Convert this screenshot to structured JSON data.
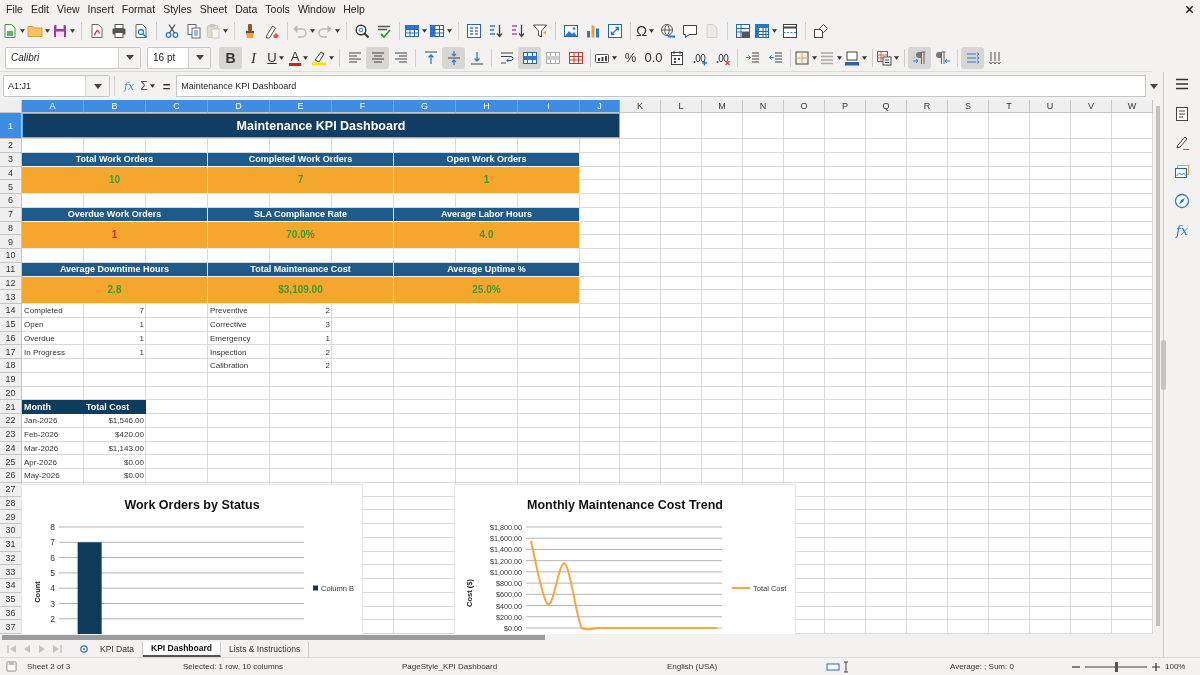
{
  "menu": [
    "File",
    "Edit",
    "View",
    "Insert",
    "Format",
    "Styles",
    "Sheet",
    "Data",
    "Tools",
    "Window",
    "Help"
  ],
  "standard_toolbar": [
    {
      "disabled": false
    },
    {
      "disabled": false
    },
    {
      "disabled": false
    },
    {
      "disabled": false
    },
    {
      "disabled": false
    },
    {
      "disabled": false
    },
    {
      "disabled": false
    },
    {
      "disabled": false
    },
    {
      "disabled": true
    },
    {
      "disabled": false
    },
    {
      "disabled": false
    },
    {
      "disabled": true
    },
    {
      "disabled": true
    },
    {
      "disabled": false
    },
    {
      "disabled": false
    },
    {
      "disabled": false
    },
    {
      "disabled": false
    },
    {
      "disabled": false
    },
    {
      "disabled": false
    },
    {
      "disabled": false
    },
    {
      "disabled": false
    },
    {
      "disabled": false
    },
    {
      "disabled": false
    },
    {
      "disabled": false
    },
    {
      "label": "Ω",
      "disabled": false
    },
    {
      "disabled": false
    },
    {
      "disabled": false
    },
    {
      "disabled": true
    },
    {
      "disabled": false
    },
    {
      "disabled": false
    },
    {
      "disabled": false
    },
    {
      "disabled": false
    }
  ],
  "formatting_toolbar": {
    "font_name": "Calibri",
    "font_size": "16 pt",
    "buttons": [
      {
        "label": "B",
        "selected": true
      },
      {
        "label": "I",
        "selected": false
      },
      {
        "label": "U",
        "selected": false
      },
      {
        "label": "A",
        "selected": false
      },
      {
        "selected": false
      },
      {
        "selected": false
      },
      {
        "selected": true
      },
      {
        "selected": false
      },
      {
        "selected": false
      },
      {
        "selected": true
      },
      {
        "selected": false
      },
      {
        "selected": false
      },
      {
        "selected": true
      },
      {
        "selected": false
      },
      {
        "selected": false
      },
      {
        "selected": false
      },
      {
        "label": "%",
        "selected": false
      },
      {
        "label": "0.0",
        "selected": false
      },
      {
        "selected": false
      },
      {
        "selected": false
      },
      {
        "selected": false
      },
      {
        "selected": false
      },
      {
        "selected": false
      },
      {
        "selected": false
      },
      {
        "selected": false
      },
      {
        "selected": false
      },
      {
        "selected": false
      },
      {
        "selected": true
      },
      {
        "selected": false
      },
      {
        "selected": true
      },
      {
        "selected": false
      }
    ]
  },
  "formula_bar": {
    "name_box": "A1:J1",
    "function_wizard": "fx",
    "sum": "Σ",
    "equals": "=",
    "content": "Maintenance KPI Dashboard"
  },
  "sidebar": {
    "functions": "fx"
  },
  "columns": [
    {
      "label": "A",
      "selected": true
    },
    {
      "label": "B",
      "selected": true
    },
    {
      "label": "C",
      "selected": true
    },
    {
      "label": "D",
      "selected": true
    },
    {
      "label": "E",
      "selected": true
    },
    {
      "label": "F",
      "selected": true
    },
    {
      "label": "G",
      "selected": true
    },
    {
      "label": "H",
      "selected": true
    },
    {
      "label": "I",
      "selected": true
    },
    {
      "label": "J",
      "selected": true
    },
    {
      "label": "K",
      "selected": false
    },
    {
      "label": "L",
      "selected": false
    },
    {
      "label": "M",
      "selected": false
    },
    {
      "label": "N",
      "selected": false
    },
    {
      "label": "O",
      "selected": false
    },
    {
      "label": "P",
      "selected": false
    },
    {
      "label": "Q",
      "selected": false
    },
    {
      "label": "R",
      "selected": false
    },
    {
      "label": "S",
      "selected": false
    },
    {
      "label": "T",
      "selected": false
    },
    {
      "label": "U",
      "selected": false
    },
    {
      "label": "V",
      "selected": false
    },
    {
      "label": "W",
      "selected": false
    }
  ],
  "rows": [
    {
      "label": "1",
      "selected": true
    },
    {
      "label": "2",
      "selected": false
    },
    {
      "label": "3",
      "selected": false
    },
    {
      "label": "4",
      "selected": false
    },
    {
      "label": "5",
      "selected": false
    },
    {
      "label": "6",
      "selected": false
    },
    {
      "label": "7",
      "selected": false
    },
    {
      "label": "8",
      "selected": false
    },
    {
      "label": "9",
      "selected": false
    },
    {
      "label": "10",
      "selected": false
    },
    {
      "label": "11",
      "selected": false
    },
    {
      "label": "12",
      "selected": false
    },
    {
      "label": "13",
      "selected": false
    },
    {
      "label": "14",
      "selected": false
    },
    {
      "label": "15",
      "selected": false
    },
    {
      "label": "16",
      "selected": false
    },
    {
      "label": "17",
      "selected": false
    },
    {
      "label": "18",
      "selected": false
    },
    {
      "label": "19",
      "selected": false
    },
    {
      "label": "20",
      "selected": false
    },
    {
      "label": "21",
      "selected": false
    },
    {
      "label": "22",
      "selected": false
    },
    {
      "label": "23",
      "selected": false
    },
    {
      "label": "24",
      "selected": false
    },
    {
      "label": "25",
      "selected": false
    },
    {
      "label": "26",
      "selected": false
    },
    {
      "label": "27",
      "selected": false
    },
    {
      "label": "28",
      "selected": false
    },
    {
      "label": "29",
      "selected": false
    },
    {
      "label": "30",
      "selected": false
    },
    {
      "label": "31",
      "selected": false
    },
    {
      "label": "32",
      "selected": false
    },
    {
      "label": "33",
      "selected": false
    },
    {
      "label": "34",
      "selected": false
    },
    {
      "label": "35",
      "selected": false
    },
    {
      "label": "36",
      "selected": false
    },
    {
      "label": "37",
      "selected": false
    }
  ],
  "sheet": {
    "title": {
      "text": "Maintenance KPI Dashboard",
      "selected": true
    },
    "kpis": [
      {
        "label": "Total Work Orders",
        "value": "10",
        "color": "#3c9a2b"
      },
      {
        "label": "Completed Work Orders",
        "value": "7",
        "color": "#3c9a2b"
      },
      {
        "label": "Open Work Orders",
        "value": "1",
        "color": "#3c9a2b"
      },
      {
        "label": "Overdue Work Orders",
        "value": "1",
        "color": "#e3261b"
      },
      {
        "label": "SLA Compliance Rate",
        "value": "70.0%",
        "color": "#3c9a2b"
      },
      {
        "label": "Average Labor Hours",
        "value": "4.0",
        "color": "#3c9a2b"
      },
      {
        "label": "Average Downtime Hours",
        "value": "2.8",
        "color": "#3c9a2b"
      },
      {
        "label": "Total Maintenance Cost",
        "value": "$3,109.00",
        "color": "#3c9a2b"
      },
      {
        "label": "Average Uptime %",
        "value": "25.0%",
        "color": "#3c9a2b"
      }
    ],
    "status_counts": [
      {
        "label": "Completed",
        "value": "7"
      },
      {
        "label": "Open",
        "value": "1"
      },
      {
        "label": "Overdue",
        "value": "1"
      },
      {
        "label": "In Progress",
        "value": "1"
      }
    ],
    "type_counts": [
      {
        "label": "Preventive",
        "value": "2"
      },
      {
        "label": "Corrective",
        "value": "3"
      },
      {
        "label": "Emergency",
        "value": "1"
      },
      {
        "label": "Inspection",
        "value": "2"
      },
      {
        "label": "Calibration",
        "value": "2"
      }
    ],
    "monthly_costs": {
      "columns": [
        "Month",
        "Total Cost"
      ],
      "rows": [
        [
          "Jan-2026",
          "$1,546.00"
        ],
        [
          "Feb-2026",
          "$420.00"
        ],
        [
          "Mar-2026",
          "$1,143.00"
        ],
        [
          "Apr-2026",
          "$0.00"
        ],
        [
          "May-2026",
          "$0.00"
        ]
      ]
    },
    "charts": [
      {
        "chart_data": {
          "type": "bar",
          "title": "Work Orders by Status",
          "ylabel": "Count",
          "ylim": [
            0,
            8
          ],
          "yticks": [
            2,
            3,
            4,
            5,
            6,
            7,
            8
          ],
          "grid": true,
          "series": [
            {
              "name": "Column B",
              "color": "#0e3a5c",
              "values": [
                7
              ]
            }
          ]
        }
      },
      {
        "chart_data": {
          "type": "line",
          "title": "Monthly Maintenance Cost Trend",
          "ylabel": "Cost ($)",
          "ylim": [
            0,
            1800
          ],
          "yticks": [
            {
              "value": 0,
              "label": "$0.00"
            },
            {
              "value": 200,
              "label": "$200.00"
            },
            {
              "value": 400,
              "label": "$400.00"
            },
            {
              "value": 600,
              "label": "$600.00"
            },
            {
              "value": 800,
              "label": "$800.00"
            },
            {
              "value": 1000,
              "label": "$1,000.00"
            },
            {
              "value": 1200,
              "label": "$1,200.00"
            },
            {
              "value": 1400,
              "label": "$1,400.00"
            },
            {
              "value": 1600,
              "label": "$1,600.00"
            },
            {
              "value": 1800,
              "label": "$1,800.00"
            }
          ],
          "grid": true,
          "series": [
            {
              "name": "Total Cost",
              "color": "#f2a93b",
              "values": [
                1550,
                420,
                1150,
                0,
                0,
                0,
                0,
                0,
                0,
                0,
                0,
                0
              ]
            }
          ]
        }
      }
    ]
  },
  "sheet_tabs": [
    {
      "label": "KPI Data",
      "selected": false
    },
    {
      "label": "KPI Dashboard",
      "selected": true
    },
    {
      "label": "Lists & Instructions",
      "selected": false
    }
  ],
  "status_bar": {
    "sheet": "Sheet 2 of 3",
    "selection": "Selected: 1 row, 10 columns",
    "page_style": "PageStyle_KPI Dashboard",
    "language": "English (USA)",
    "summary": "Average: ; Sum: 0",
    "zoom": {
      "level": 0.5,
      "label": "100%"
    }
  }
}
